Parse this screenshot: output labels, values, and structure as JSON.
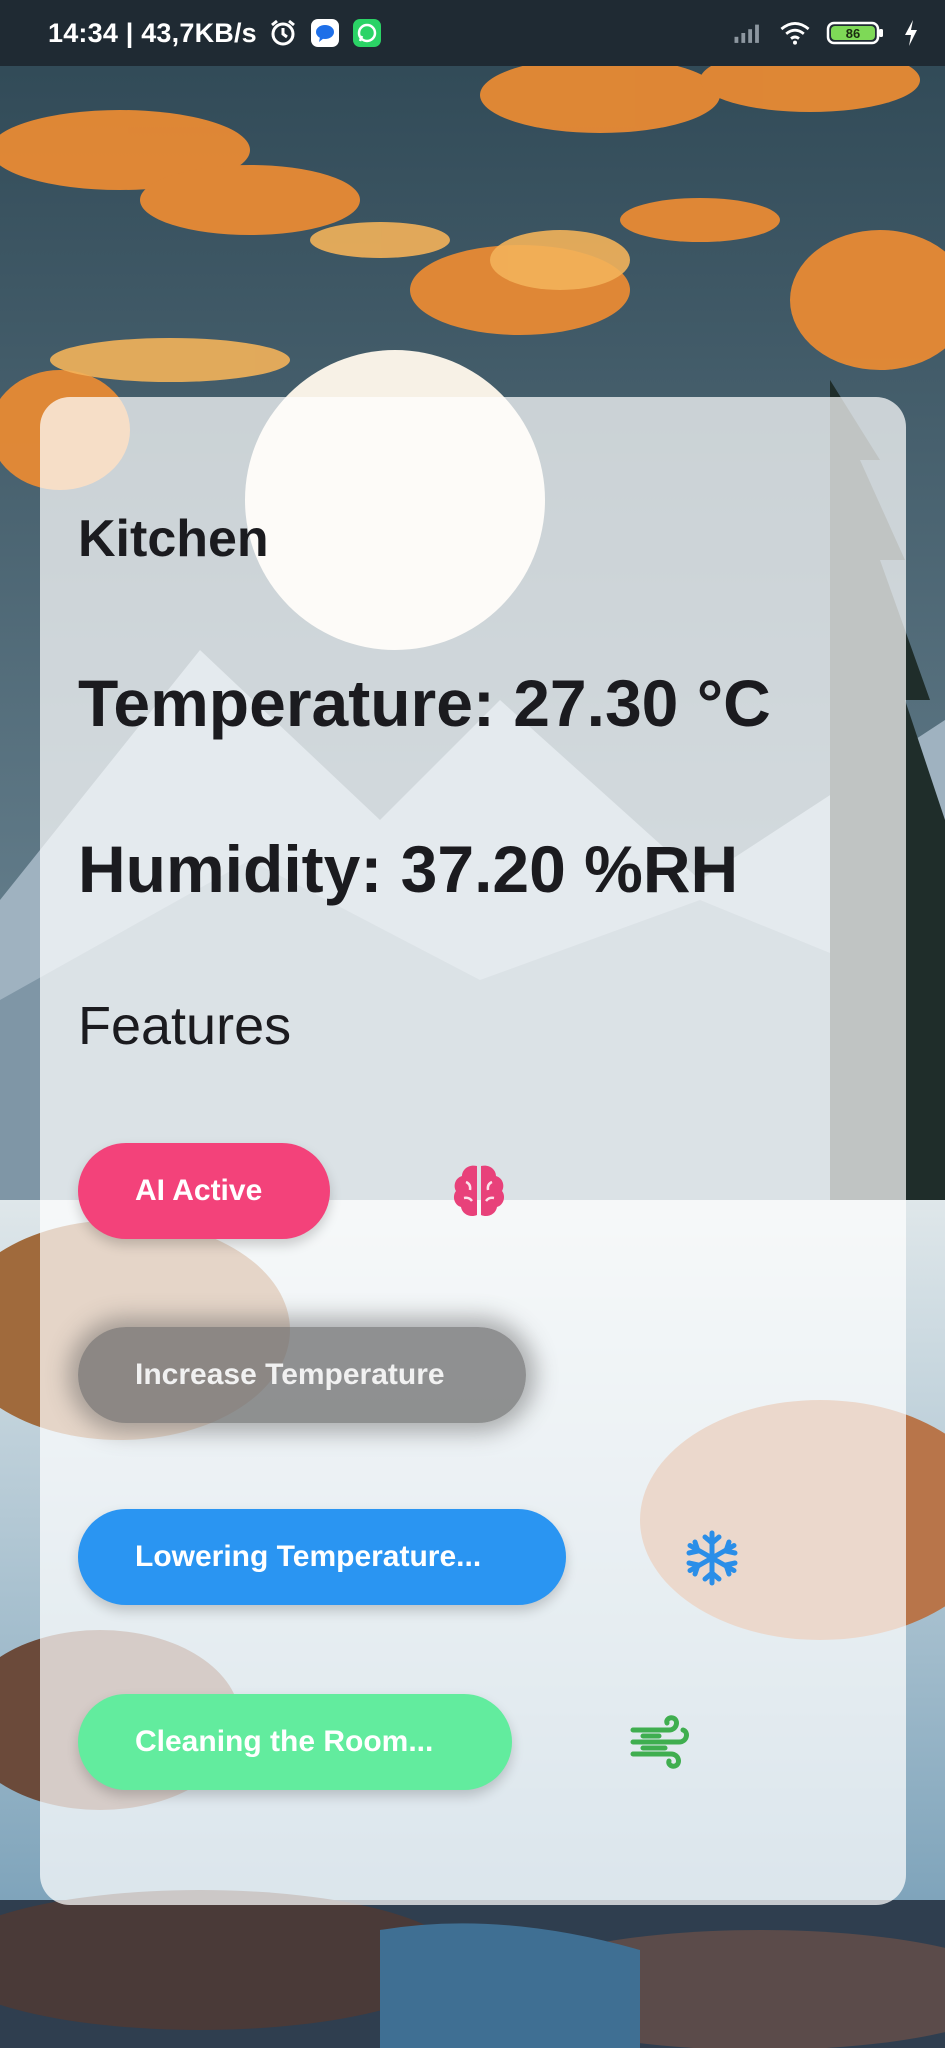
{
  "status_bar": {
    "time_speed": "14:34 | 43,7KB/s",
    "battery_level": "86",
    "icons": [
      "alarm-icon",
      "messenger-icon",
      "whatsapp-icon",
      "signal-icon",
      "wifi-icon",
      "battery-icon",
      "charging-icon"
    ]
  },
  "card": {
    "room_name": "Kitchen",
    "temperature": "Temperature: 27.30 °C",
    "humidity": "Humidity: 37.20 %RH",
    "features_title": "Features"
  },
  "features": {
    "ai_active": {
      "label": "AI Active",
      "color": "#f3427a",
      "icon": "brain-icon"
    },
    "increase_temp": {
      "label": "Increase Temperature",
      "color": "#6b6b6b"
    },
    "lowering_temp": {
      "label": "Lowering Temperature...",
      "color": "#2a95f2",
      "icon": "snowflake-icon"
    },
    "cleaning": {
      "label": "Cleaning the Room...",
      "color": "#62ec9e",
      "icon": "wind-icon"
    }
  },
  "colors": {
    "icon_brain": "#e8417a",
    "icon_snow": "#2a8ee8",
    "icon_wind": "#3fae4f"
  }
}
